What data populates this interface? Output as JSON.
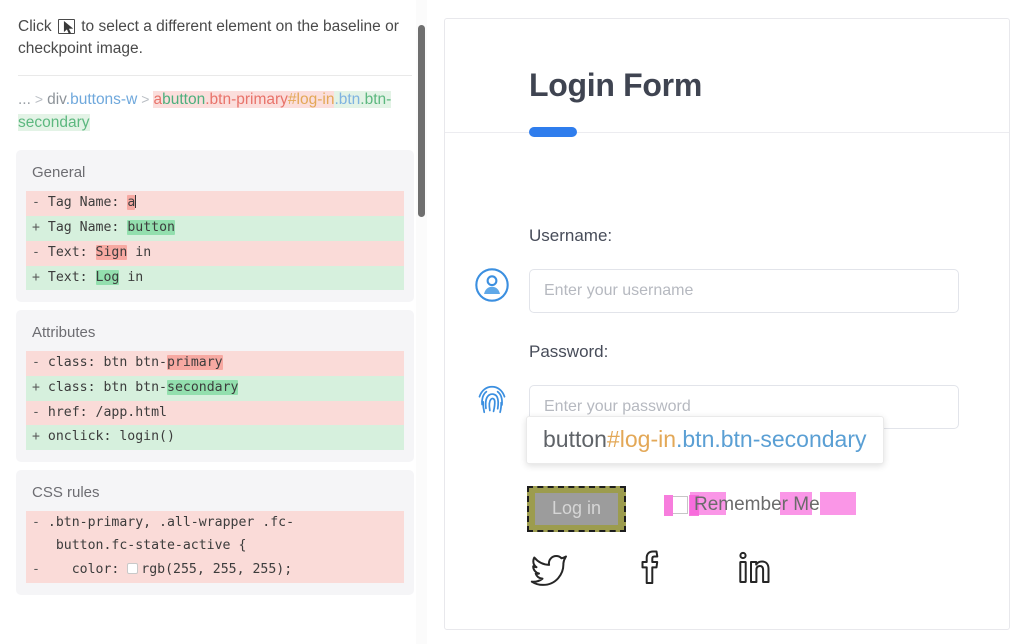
{
  "left_panel": {
    "intro": {
      "text_before": "Click",
      "icon": "element-picker-icon",
      "text_after": "to select a different element on the baseline or checkpoint image."
    },
    "breadcrumb": {
      "ellipsis": "...",
      "separator": ">",
      "parts": [
        {
          "text": "div",
          "kind": "tag"
        },
        {
          "text": ".buttons-w",
          "kind": "class"
        },
        {
          "text": "a",
          "kind": "removed-tag"
        },
        {
          "text": "button",
          "kind": "added-tag"
        },
        {
          "text": ".btn-primary",
          "kind": "removed-class"
        },
        {
          "text": "#log-in",
          "kind": "id"
        },
        {
          "text": ".btn",
          "kind": "class-kept"
        },
        {
          "text": ".btn-secondary",
          "kind": "added-class"
        }
      ]
    },
    "sections": [
      {
        "title": "General",
        "rows": [
          {
            "sign": "-",
            "type": "del",
            "prefix": "Tag Name: ",
            "highlight": "a",
            "suffix": "",
            "caret": true
          },
          {
            "sign": "+",
            "type": "ins",
            "prefix": "Tag Name: ",
            "highlight": "button",
            "suffix": ""
          },
          {
            "sign": "-",
            "type": "del",
            "prefix": "Text: ",
            "highlight": "Sign",
            "suffix": " in"
          },
          {
            "sign": "+",
            "type": "ins",
            "prefix": "Text: ",
            "highlight": "Log",
            "suffix": " in"
          }
        ]
      },
      {
        "title": "Attributes",
        "rows": [
          {
            "sign": "-",
            "type": "del",
            "prefix": "class: btn btn-",
            "highlight": "primary",
            "suffix": ""
          },
          {
            "sign": "+",
            "type": "ins",
            "prefix": "class: btn btn-",
            "highlight": "secondary",
            "suffix": ""
          },
          {
            "sign": "-",
            "type": "del",
            "prefix": "href: /app.html",
            "highlight": "",
            "suffix": ""
          },
          {
            "sign": "+",
            "type": "ins",
            "prefix": "onclick: login()",
            "highlight": "",
            "suffix": ""
          }
        ]
      },
      {
        "title": "CSS rules",
        "rows": [
          {
            "sign": "-",
            "type": "del",
            "prefix": " .btn-primary, .all-wrapper .fc-\n   button.fc-state-active {",
            "highlight": "",
            "suffix": ""
          },
          {
            "sign": "-",
            "type": "del",
            "prefix": "    color: ",
            "highlight": "",
            "suffix": "rgb(255, 255, 255);",
            "swatch": "#ffffff"
          }
        ]
      }
    ],
    "scrollbar": {
      "name": "vertical-scrollbar"
    }
  },
  "right_panel": {
    "title": "Login Form",
    "accent_color": "#2f7ded",
    "username": {
      "label": "Username:",
      "placeholder": "Enter your username",
      "value": "",
      "icon": "user-circle-icon"
    },
    "password": {
      "label": "Password:",
      "placeholder": "Enter your password",
      "value": "",
      "icon": "fingerprint-icon"
    },
    "tooltip": {
      "tag": "button",
      "id": "#log-in",
      "classes": ".btn.btn-secondary"
    },
    "login_button": {
      "label": "Log in",
      "highlight_color": "#9c9c4e"
    },
    "remember": {
      "label": "Remember Me",
      "checked": false,
      "diff_color": "#f764dc"
    },
    "socials": [
      {
        "name": "twitter-icon"
      },
      {
        "name": "facebook-icon"
      },
      {
        "name": "linkedin-icon"
      }
    ]
  }
}
